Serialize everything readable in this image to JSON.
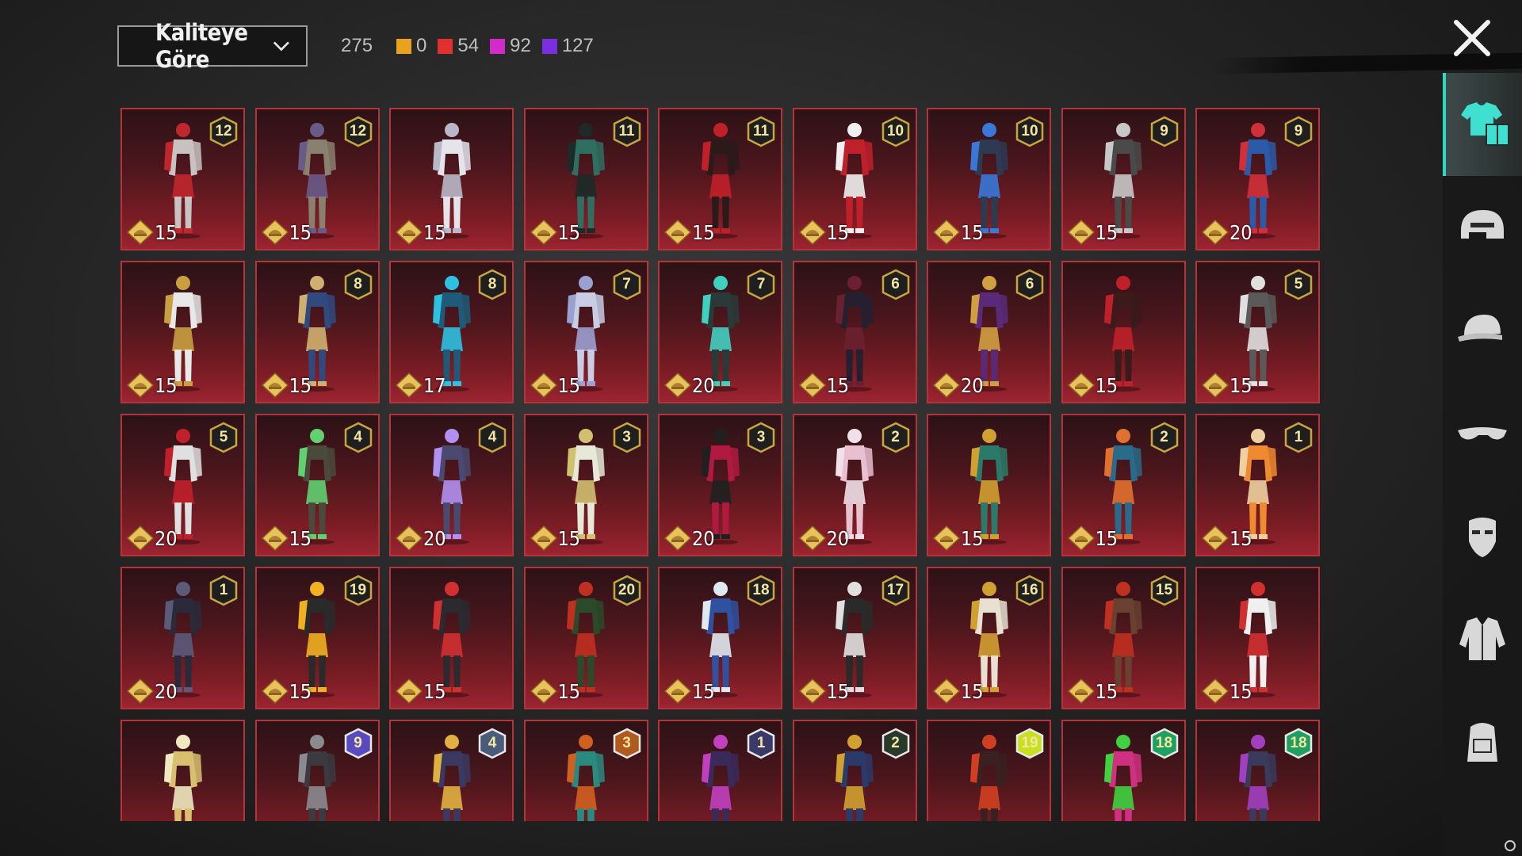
{
  "sort": {
    "label": "Kaliteye Göre"
  },
  "total_count": "275",
  "quality_counts": [
    {
      "color": "#e8a21d",
      "value": "0"
    },
    {
      "color": "#e03030",
      "value": "54"
    },
    {
      "color": "#d12cc8",
      "value": "92"
    },
    {
      "color": "#7a2ee0",
      "value": "127"
    }
  ],
  "items": [
    {
      "rank": "12",
      "price": "15",
      "tone": "#c9c2c2",
      "accent": "#c0272d"
    },
    {
      "rank": "12",
      "price": "15",
      "tone": "#8a8070",
      "accent": "#6a5a8a"
    },
    {
      "rank": "",
      "price": "15",
      "tone": "#e4e4ea",
      "accent": "#b8b8c8"
    },
    {
      "rank": "11",
      "price": "15",
      "tone": "#2f6f62",
      "accent": "#1d2a28"
    },
    {
      "rank": "11",
      "price": "15",
      "tone": "#2a1a1a",
      "accent": "#c0202a"
    },
    {
      "rank": "10",
      "price": "15",
      "tone": "#c0202a",
      "accent": "#f0f0f0"
    },
    {
      "rank": "10",
      "price": "15",
      "tone": "#2c3a52",
      "accent": "#3a78d8"
    },
    {
      "rank": "9",
      "price": "15",
      "tone": "#4a4a4a",
      "accent": "#c8c8c8"
    },
    {
      "rank": "9",
      "price": "20",
      "tone": "#2a5aa8",
      "accent": "#d0303a"
    },
    {
      "rank": "",
      "price": "15",
      "tone": "#e8e8e8",
      "accent": "#c8a040"
    },
    {
      "rank": "8",
      "price": "15",
      "tone": "#304a80",
      "accent": "#d0b070"
    },
    {
      "rank": "8",
      "price": "17",
      "tone": "#1f5a78",
      "accent": "#2ec0e0"
    },
    {
      "rank": "7",
      "price": "15",
      "tone": "#c8cce4",
      "accent": "#9aa0d0"
    },
    {
      "rank": "7",
      "price": "20",
      "tone": "#2a3a38",
      "accent": "#40d0c0"
    },
    {
      "rank": "6",
      "price": "15",
      "tone": "#252030",
      "accent": "#6a2030"
    },
    {
      "rank": "6",
      "price": "20",
      "tone": "#5a2a7a",
      "accent": "#d0a040"
    },
    {
      "rank": "",
      "price": "15",
      "tone": "#3a1a1a",
      "accent": "#c0202a"
    },
    {
      "rank": "5",
      "price": "15",
      "tone": "#5a5a5a",
      "accent": "#e0e0e0"
    },
    {
      "rank": "5",
      "price": "20",
      "tone": "#e0e0e0",
      "accent": "#c0202a"
    },
    {
      "rank": "4",
      "price": "15",
      "tone": "#4a4a3a",
      "accent": "#60d070"
    },
    {
      "rank": "4",
      "price": "20",
      "tone": "#4a4a70",
      "accent": "#b090f0"
    },
    {
      "rank": "3",
      "price": "15",
      "tone": "#e8e8d8",
      "accent": "#d0c070"
    },
    {
      "rank": "3",
      "price": "20",
      "tone": "#b01a40",
      "accent": "#202020"
    },
    {
      "rank": "2",
      "price": "20",
      "tone": "#e8c0d0",
      "accent": "#f0e0e8"
    },
    {
      "rank": "",
      "price": "15",
      "tone": "#2a7a6a",
      "accent": "#d0a030"
    },
    {
      "rank": "2",
      "price": "15",
      "tone": "#2a6a8a",
      "accent": "#e07030"
    },
    {
      "rank": "1",
      "price": "15",
      "tone": "#f08a30",
      "accent": "#f0d0a0"
    },
    {
      "rank": "1",
      "price": "20",
      "tone": "#2a2a3a",
      "accent": "#5a5a7a"
    },
    {
      "rank": "19",
      "price": "15",
      "tone": "#2a2a2a",
      "accent": "#f0b020"
    },
    {
      "rank": "",
      "price": "15",
      "tone": "#2a2a30",
      "accent": "#d03030"
    },
    {
      "rank": "20",
      "price": "15",
      "tone": "#2a4a2a",
      "accent": "#c03020"
    },
    {
      "rank": "18",
      "price": "15",
      "tone": "#3050a0",
      "accent": "#e0e8f0"
    },
    {
      "rank": "17",
      "price": "15",
      "tone": "#2a2a2a",
      "accent": "#e0e0e0"
    },
    {
      "rank": "16",
      "price": "15",
      "tone": "#e8e0d0",
      "accent": "#d0a030"
    },
    {
      "rank": "15",
      "price": "15",
      "tone": "#6a4030",
      "accent": "#c03020"
    },
    {
      "rank": "",
      "price": "15",
      "tone": "#f0f0f0",
      "accent": "#d03030"
    },
    {
      "rank": "",
      "price": "",
      "tone": "#d8c070",
      "accent": "#f0e8c0"
    },
    {
      "rank": "9",
      "price": "",
      "tone": "#3a3a40",
      "accent": "#8a8a90",
      "badge": "#5a4ac0"
    },
    {
      "rank": "4",
      "price": "",
      "tone": "#3a3a60",
      "accent": "#e0b040",
      "badge": "#4a5a7a"
    },
    {
      "rank": "3",
      "price": "",
      "tone": "#2a8a80",
      "accent": "#d06020",
      "badge": "#b05a20"
    },
    {
      "rank": "1",
      "price": "",
      "tone": "#3a2a5a",
      "accent": "#c040c0",
      "badge": "#3a3a6a"
    },
    {
      "rank": "2",
      "price": "",
      "tone": "#2a3a6a",
      "accent": "#d0a030",
      "badge": "#2a3a2a"
    },
    {
      "rank": "19",
      "price": "",
      "tone": "#3a2020",
      "accent": "#d04020",
      "badge": "#c8e020"
    },
    {
      "rank": "18",
      "price": "",
      "tone": "#d03080",
      "accent": "#40d040",
      "badge": "#20a060"
    },
    {
      "rank": "18",
      "price": "",
      "tone": "#3a3a5a",
      "accent": "#a040c0",
      "badge": "#20a060"
    }
  ],
  "sidebar": {
    "tabs": [
      {
        "icon": "outfit-icon"
      },
      {
        "icon": "helmet-icon"
      },
      {
        "icon": "cap-icon"
      },
      {
        "icon": "glasses-icon"
      },
      {
        "icon": "mask-icon"
      },
      {
        "icon": "jacket-icon"
      },
      {
        "icon": "backpack-icon"
      }
    ]
  }
}
